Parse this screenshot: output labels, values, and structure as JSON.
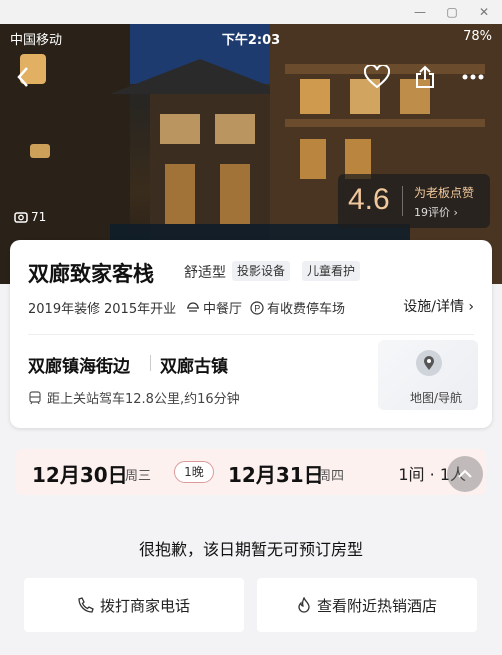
{
  "status_bar": {
    "carrier": "中国移动",
    "time": "下午2:03",
    "battery": "78%"
  },
  "hero": {
    "photo_count": "71",
    "score": "4.6",
    "score_label": "为老板点赞",
    "reviews": "19评价 ›"
  },
  "hotel": {
    "name": "双廊致家客栈",
    "type": "舒适型",
    "tags": [
      "投影设备",
      "儿童看护"
    ],
    "renovated": "2019年装修",
    "opened": "2015年开业",
    "amenity_restaurant": "中餐厅",
    "amenity_parking": "有收费停车场",
    "facilities_link": "设施/详情 ›"
  },
  "location": {
    "area": "双廊镇海街边",
    "district": "双廊古镇",
    "distance": "距上关站驾车12.8公里,约16分钟",
    "map_label": "地图/导航"
  },
  "booking": {
    "checkin_date": "12月30日",
    "checkin_weekday": "周三",
    "nights": "1晚",
    "checkout_date": "12月31日",
    "checkout_weekday": "周四",
    "rooms_guests": "1间 · 1人"
  },
  "notice": "很抱歉，该日期暂无可预订房型",
  "actions": {
    "call_label": "拨打商家电话",
    "nearby_label": "查看附近热销酒店"
  },
  "colors": {
    "score": "#f0c89c",
    "date_bar_bg": "#fdf1f0"
  }
}
